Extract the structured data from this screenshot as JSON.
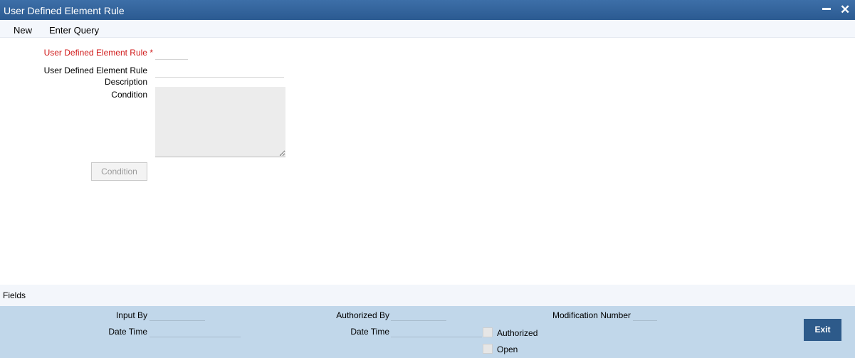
{
  "window": {
    "title": "User Defined Element Rule",
    "minimize_glyph": "▬",
    "close_glyph": "✕"
  },
  "menu": {
    "new_label": "New",
    "enter_query_label": "Enter Query"
  },
  "form": {
    "rule_label": "User Defined Element Rule",
    "required_mark": "*",
    "rule_value": "",
    "desc_label_line1": "User Defined Element Rule",
    "desc_label_line2": "Description",
    "desc_value": "",
    "condition_label": "Condition",
    "condition_value": "",
    "condition_button_label": "Condition"
  },
  "fields_bar": {
    "label": "Fields"
  },
  "audit": {
    "input_by_label": "Input By",
    "input_by_value": "",
    "date_time_label": "Date Time",
    "date_time_value": "",
    "authorized_by_label": "Authorized By",
    "authorized_by_value": "",
    "auth_date_time_label": "Date Time",
    "auth_date_time_value": "",
    "modification_number_label": "Modification Number",
    "modification_number_value": "",
    "authorized_label": "Authorized",
    "authorized_checked": false,
    "open_label": "Open",
    "open_checked": false,
    "exit_label": "Exit"
  },
  "colors": {
    "title_bar": "#2b5a91",
    "required_label": "#d01818",
    "footer": "#c1d7ea",
    "exit_button": "#2d5a8a"
  }
}
